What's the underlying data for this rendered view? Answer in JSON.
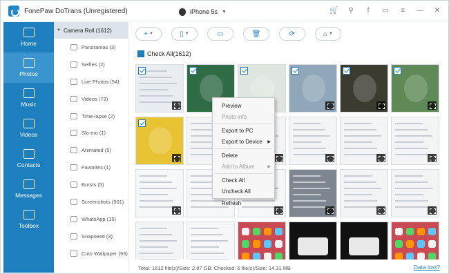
{
  "window": {
    "title": "FonePaw DoTrans (Unregistered)"
  },
  "device": {
    "name": "iPhone 5s"
  },
  "titlebar_icons": [
    "cart-icon",
    "key-icon",
    "facebook-icon",
    "chat-icon",
    "menu-icon",
    "minimize-icon",
    "close-icon"
  ],
  "titlebar_glyphs": [
    "🛒",
    "⚲",
    "f",
    "▭",
    "≡",
    "—",
    "✕"
  ],
  "nav": [
    {
      "label": "Home",
      "active": false
    },
    {
      "label": "Photos",
      "active": true
    },
    {
      "label": "Music",
      "active": false
    },
    {
      "label": "Videos",
      "active": false
    },
    {
      "label": "Contacts",
      "active": false
    },
    {
      "label": "Messages",
      "active": false
    },
    {
      "label": "Toolbox",
      "active": false
    }
  ],
  "sidebar": {
    "header": "Camera Roll (1612)",
    "items": [
      "Panoramas (3)",
      "Selfies (2)",
      "Live Photos (54)",
      "Videos (73)",
      "Time-lapse (2)",
      "Slo-mo (1)",
      "Animated (5)",
      "Favorites (1)",
      "Bursts (5)",
      "Screenshots (901)",
      "WhatsApp (15)",
      "Snapseed (3)",
      "Cuto Wallpaper (93)"
    ]
  },
  "toolbar": [
    {
      "name": "add",
      "glyph": "+",
      "caret": true
    },
    {
      "name": "export-to-device",
      "glyph": "▯",
      "caret": true
    },
    {
      "name": "export-to-pc",
      "glyph": "▭",
      "caret": false
    },
    {
      "name": "delete",
      "glyph": "🗑",
      "caret": false
    },
    {
      "name": "refresh",
      "glyph": "⟳",
      "caret": false
    },
    {
      "name": "toolbox",
      "glyph": "⌂",
      "caret": true
    }
  ],
  "check_all_label": "Check All(1612)",
  "context_menu": [
    {
      "label": "Preview",
      "disabled": false,
      "submenu": false
    },
    {
      "label": "Photo info",
      "disabled": true,
      "submenu": false
    },
    {
      "sep": true
    },
    {
      "label": "Export to PC",
      "disabled": false,
      "submenu": false
    },
    {
      "label": "Export to Device",
      "disabled": false,
      "submenu": true
    },
    {
      "sep": true
    },
    {
      "label": "Delete",
      "disabled": false,
      "submenu": false
    },
    {
      "label": "Add to Album",
      "disabled": true,
      "submenu": true
    },
    {
      "sep": true
    },
    {
      "label": "Check All",
      "disabled": false,
      "submenu": false
    },
    {
      "label": "Uncheck All",
      "disabled": false,
      "submenu": false
    },
    {
      "label": "Refresh",
      "disabled": false,
      "submenu": false
    }
  ],
  "status": "Total: 1612 file(s)/Size: 2.87 GB; Checked: 6 file(s)/Size: 14.31 MB",
  "data_lost_link": "Data lost?",
  "thumbnails": [
    {
      "kind": "screen",
      "bg": "#e9edf2",
      "checked": true,
      "action": "trash"
    },
    {
      "kind": "plant",
      "bg": "#2f6b45",
      "checked": true,
      "action": "none"
    },
    {
      "kind": "plant",
      "bg": "#dfe6df",
      "checked": true,
      "action": "none"
    },
    {
      "kind": "plant",
      "bg": "#8fa7b8",
      "checked": true,
      "action": "expand"
    },
    {
      "kind": "plant",
      "bg": "#3b3b30",
      "checked": true,
      "action": "trash"
    },
    {
      "kind": "plant",
      "bg": "#5f8a57",
      "checked": true,
      "action": "expand"
    },
    {
      "kind": "plant",
      "bg": "#e8c435",
      "checked": true,
      "action": "expand"
    },
    {
      "kind": "screen",
      "bg": "#f2f4f6",
      "checked": false,
      "action": "none"
    },
    {
      "kind": "screen",
      "bg": "#f2f4f6",
      "checked": false,
      "action": "trash"
    },
    {
      "kind": "screen",
      "bg": "#f2f4f6",
      "checked": false,
      "action": "trash"
    },
    {
      "kind": "screen",
      "bg": "#f2f4f6",
      "checked": false,
      "action": "expand"
    },
    {
      "kind": "screen",
      "bg": "#f2f4f6",
      "checked": false,
      "action": "expand"
    },
    {
      "kind": "screen",
      "bg": "#f6f7f8",
      "checked": false,
      "action": "expand"
    },
    {
      "kind": "screen",
      "bg": "#f6f7f8",
      "checked": false,
      "action": "none"
    },
    {
      "kind": "screen",
      "bg": "#f6f7f8",
      "checked": false,
      "action": "expand"
    },
    {
      "kind": "screen",
      "bg": "#7e8790",
      "checked": false,
      "action": "video"
    },
    {
      "kind": "screen",
      "bg": "#f2f4f6",
      "checked": false,
      "action": "expand"
    },
    {
      "kind": "screen",
      "bg": "#f2f4f6",
      "checked": false,
      "action": "expand"
    },
    {
      "kind": "screen",
      "bg": "#f2f4f6",
      "checked": false,
      "action": "none"
    },
    {
      "kind": "screen",
      "bg": "#f6f7f8",
      "checked": false,
      "action": "none"
    },
    {
      "kind": "apps",
      "bg": "#c94a55",
      "checked": false,
      "action": "none"
    },
    {
      "kind": "dark",
      "bg": "#111111",
      "checked": false,
      "action": "none"
    },
    {
      "kind": "dark",
      "bg": "#111111",
      "checked": false,
      "action": "none"
    },
    {
      "kind": "apps",
      "bg": "#c94a55",
      "checked": false,
      "action": "none"
    }
  ]
}
